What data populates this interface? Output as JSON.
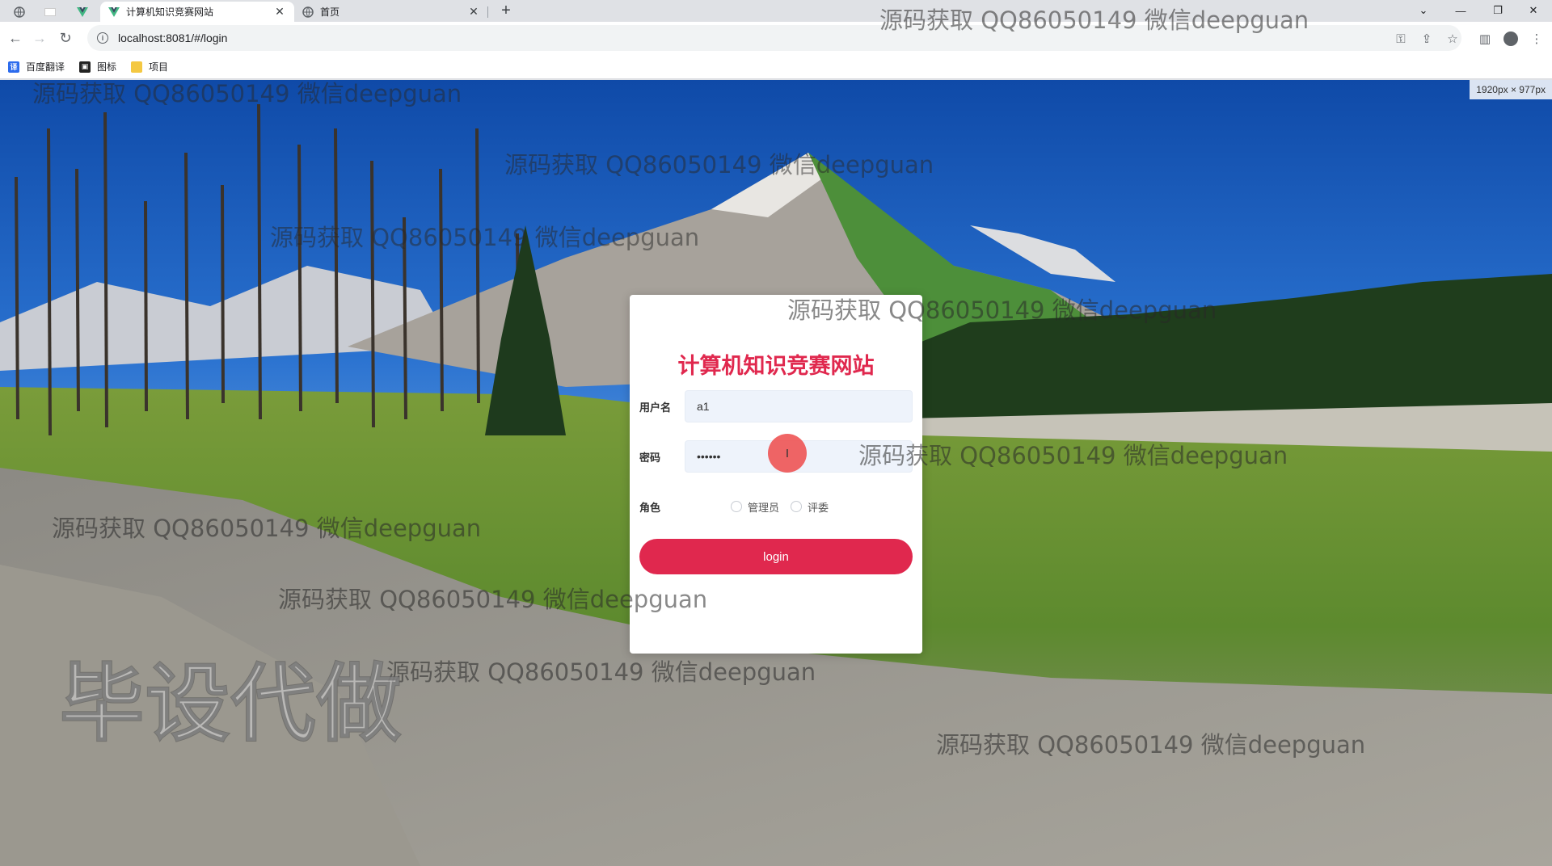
{
  "browser": {
    "tabs": [
      {
        "title": "计算机知识竞赛网站",
        "active": true
      },
      {
        "title": "首页",
        "active": false
      }
    ],
    "address": "localhost:8081/#/login",
    "bookmarks": [
      "百度翻译",
      "图标",
      "项目"
    ]
  },
  "viewport_badge": "1920px × 977px",
  "login": {
    "title": "计算机知识竞赛网站",
    "username_label": "用户名",
    "username_value": "a1",
    "password_label": "密码",
    "password_value": "••••••",
    "role_label": "角色",
    "roles": [
      "管理员",
      "评委"
    ],
    "submit_label": "login",
    "cursor_glyph": "I"
  },
  "watermark": {
    "text": "源码获取 QQ86050149 微信deepguan",
    "big_text": "毕设代做"
  },
  "colors": {
    "accent": "#e0284e",
    "input_bg": "#eef3fb",
    "sky": "#1f5fb8"
  }
}
